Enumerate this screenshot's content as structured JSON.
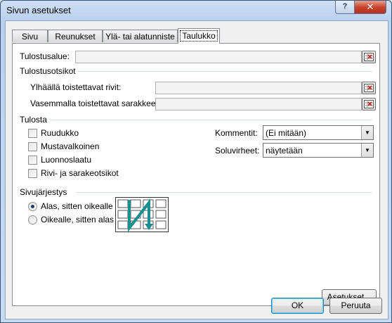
{
  "window": {
    "title": "Sivun asetukset",
    "help_label": "?",
    "close_label": "✕"
  },
  "tabs": [
    {
      "label": "Sivu",
      "active": false
    },
    {
      "label": "Reunukset",
      "active": false
    },
    {
      "label": "Ylä- tai alatunniste",
      "active": false
    },
    {
      "label": "Taulukko",
      "active": true
    }
  ],
  "print_area": {
    "label": "Tulostusalue:",
    "value": ""
  },
  "print_titles": {
    "heading": "Tulostusotsikot",
    "rows_label": "Ylhäällä toistettavat rivit:",
    "rows_value": "",
    "cols_label": "Vasemmalla toistettavat sarakkeet:",
    "cols_value": ""
  },
  "print": {
    "heading": "Tulosta",
    "checkboxes": [
      {
        "label": "Ruudukko",
        "checked": false
      },
      {
        "label": "Mustavalkoinen",
        "checked": false
      },
      {
        "label": "Luonnoslaatu",
        "checked": false
      },
      {
        "label": "Rivi- ja sarakeotsikot",
        "checked": false
      }
    ],
    "comments_label": "Kommentit:",
    "comments_value": "(Ei mitään)",
    "errors_label": "Soluvirheet:",
    "errors_value": "näytetään"
  },
  "page_order": {
    "heading": "Sivujärjestys",
    "options": [
      {
        "label": "Alas, sitten oikealle",
        "selected": true
      },
      {
        "label": "Oikealle, sitten alas",
        "selected": false
      }
    ]
  },
  "buttons": {
    "options": "Asetukset...",
    "ok": "OK",
    "cancel": "Peruuta"
  },
  "colors": {
    "accent": "#3c7fb1",
    "order_arrow": "#1a8f8f"
  }
}
